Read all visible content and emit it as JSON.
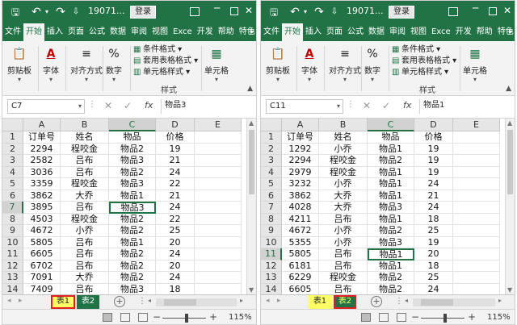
{
  "colors": {
    "brand": "#217346",
    "sheet1_tab_bg": "#ffff66",
    "sheet2_tab_bg": "#217346",
    "highlight_outline": "#e02020"
  },
  "titlebar": {
    "title": "19071...",
    "login_label": "登录",
    "icons": [
      "save-icon",
      "undo-icon",
      "redo-icon",
      "minimize-icon",
      "restore-icon",
      "close-icon"
    ]
  },
  "tabs": [
    "文件",
    "开始",
    "插入",
    "页面",
    "公式",
    "数据",
    "审阅",
    "视图",
    "Exce",
    "开发",
    "帮助",
    "特色"
  ],
  "tab_scroll": "▸",
  "ribbon": {
    "clipboard": "剪贴板",
    "font": "字体",
    "align": "对齐方式",
    "number": "数字",
    "cond_format": "条件格式 ▾",
    "table_format": "套用表格格式 ▾",
    "cell_style": "单元格样式 ▾",
    "styles_caption": "样式",
    "cells": "单元格"
  },
  "formula_bar": {
    "fx": "fx",
    "left": {
      "name_box": "C7",
      "value": "物品3"
    },
    "right": {
      "name_box": "C11",
      "value": "物品1"
    }
  },
  "grid": {
    "columns": [
      "A",
      "B",
      "C",
      "D",
      "E"
    ],
    "row_numbers": [
      "1",
      "2",
      "3",
      "4",
      "5",
      "6",
      "7",
      "8",
      "9",
      "10",
      "11",
      "12",
      "13",
      "14"
    ]
  },
  "left_sheet": {
    "rows": [
      [
        "订单号",
        "姓名",
        "物品",
        "价格"
      ],
      [
        "2294",
        "程咬金",
        "物品2",
        "19"
      ],
      [
        "2582",
        "吕布",
        "物品3",
        "21"
      ],
      [
        "3036",
        "吕布",
        "物品2",
        "24"
      ],
      [
        "3359",
        "程咬金",
        "物品3",
        "22"
      ],
      [
        "3862",
        "大乔",
        "物品1",
        "21"
      ],
      [
        "3895",
        "吕布",
        "物品3",
        "24"
      ],
      [
        "4503",
        "程咬金",
        "物品2",
        "22"
      ],
      [
        "4672",
        "小乔",
        "物品2",
        "25"
      ],
      [
        "5805",
        "吕布",
        "物品1",
        "20"
      ],
      [
        "6605",
        "吕布",
        "物品2",
        "24"
      ],
      [
        "6702",
        "吕布",
        "物品2",
        "20"
      ],
      [
        "7091",
        "大乔",
        "物品2",
        "24"
      ],
      [
        "7409",
        "吕布",
        "物品3",
        "18"
      ]
    ]
  },
  "right_sheet": {
    "rows": [
      [
        "订单号",
        "姓名",
        "物品",
        "价格"
      ],
      [
        "1292",
        "小乔",
        "物品1",
        "19"
      ],
      [
        "2294",
        "程咬金",
        "物品2",
        "19"
      ],
      [
        "2979",
        "程咬金",
        "物品1",
        "19"
      ],
      [
        "3232",
        "小乔",
        "物品1",
        "24"
      ],
      [
        "3862",
        "大乔",
        "物品1",
        "21"
      ],
      [
        "4028",
        "大乔",
        "物品3",
        "24"
      ],
      [
        "4211",
        "吕布",
        "物品1",
        "18"
      ],
      [
        "4672",
        "小乔",
        "物品2",
        "25"
      ],
      [
        "5355",
        "小乔",
        "物品3",
        "19"
      ],
      [
        "5805",
        "吕布",
        "物品1",
        "20"
      ],
      [
        "6181",
        "吕布",
        "物品1",
        "18"
      ],
      [
        "6229",
        "程咬金",
        "物品2",
        "25"
      ],
      [
        "6605",
        "吕布",
        "物品2",
        "24"
      ]
    ]
  },
  "sheet_tabs": [
    "表1",
    "表2"
  ],
  "status": {
    "zoom": "115%"
  }
}
